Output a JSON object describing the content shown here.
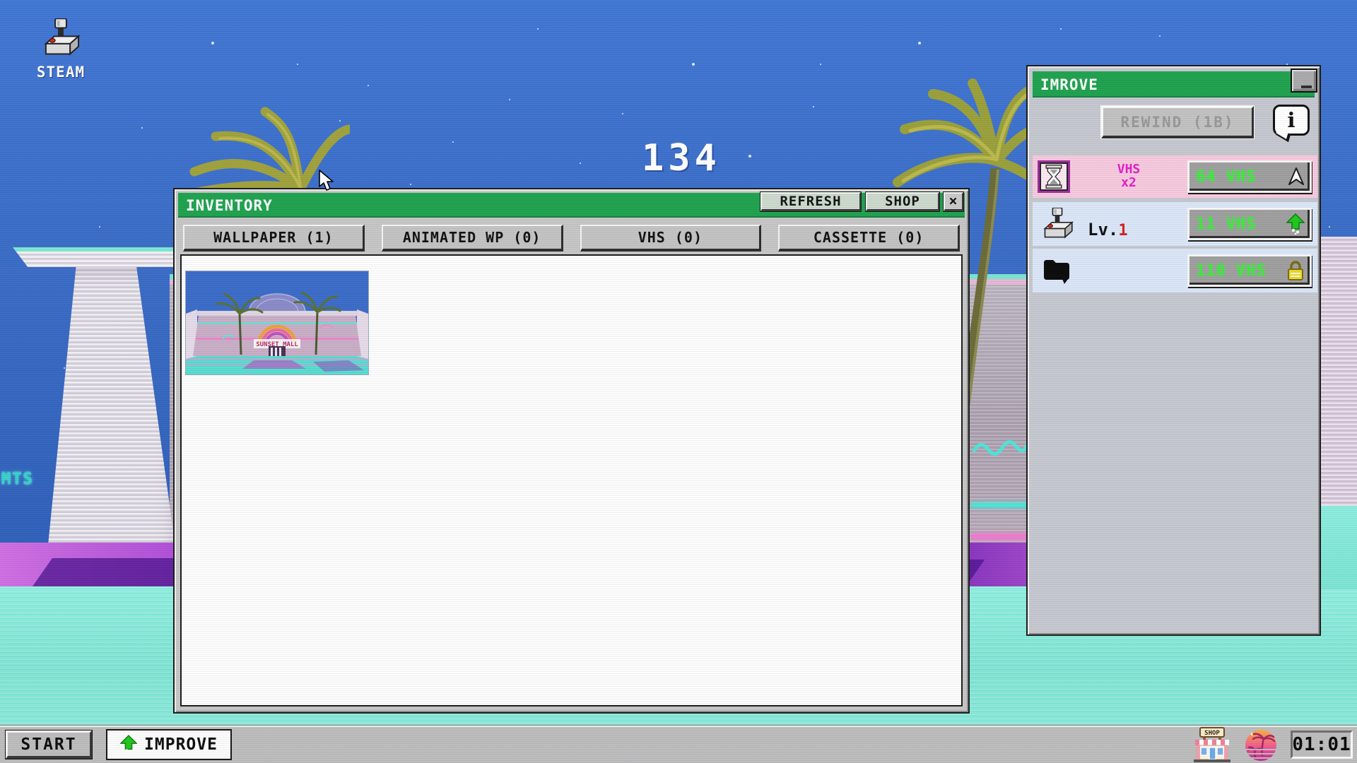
{
  "desktop": {
    "steam_label": "STEAM",
    "counter": "134",
    "neon_sign": "MTS"
  },
  "inventory": {
    "title": "INVENTORY",
    "refresh": "REFRESH",
    "shop": "SHOP",
    "close": "×",
    "tabs": [
      {
        "label": "WALLPAPER (1)"
      },
      {
        "label": "ANIMATED WP (0)"
      },
      {
        "label": "VHS (0)"
      },
      {
        "label": "CASSETTE (0)"
      }
    ],
    "thumb_caption": "SUNSET MALL"
  },
  "improve": {
    "title": "IMROVE",
    "rewind": "REWIND (1B)",
    "info": "i",
    "rows": [
      {
        "icon": "hourglass-icon",
        "label1": "VHS",
        "label2": "x2",
        "price": "64 VHS",
        "status": "white-arrow-icon"
      },
      {
        "icon": "joystick-icon",
        "label1": "Lv.",
        "level": "1",
        "price": "11 VHS",
        "status": "green-up-arrow-icon"
      },
      {
        "icon": "folder-icon",
        "price": "110 VHS",
        "status": "lock-icon"
      }
    ]
  },
  "taskbar": {
    "start": "START",
    "improve_task": "IMPROVE",
    "shop_sign": "SHOP",
    "clock": "01:01"
  },
  "colors": {
    "titlebar_green": "#1fa24e",
    "sky_blue": "#3a6cc6",
    "ground_teal": "#7ce4d3",
    "row_pink": "#f7c9dd",
    "row_blue": "#dae7f7",
    "price_green": "#3ee83e",
    "magenta": "#e41ec8"
  }
}
